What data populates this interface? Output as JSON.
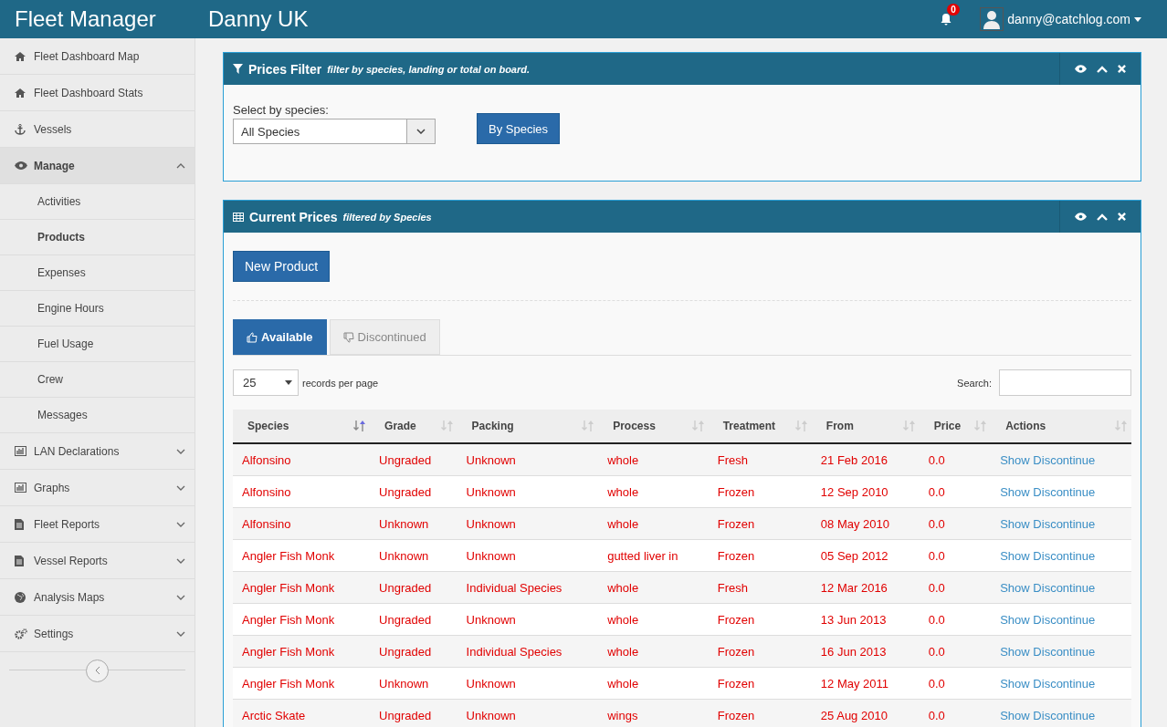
{
  "header": {
    "brand": "Fleet Manager",
    "account": "Danny UK",
    "notifications": "0",
    "user": "danny@catchlog.com"
  },
  "sidebar": {
    "items": [
      {
        "label": "Fleet Dashboard Map",
        "selected": false
      },
      {
        "label": "Fleet Dashboard Stats",
        "selected": false
      },
      {
        "label": "Vessels",
        "selected": false
      },
      {
        "label": "Manage",
        "expanded": true,
        "selected": true,
        "children": [
          {
            "label": "Activities",
            "selected": false
          },
          {
            "label": "Products",
            "selected": true
          },
          {
            "label": "Expenses",
            "selected": false
          },
          {
            "label": "Engine Hours",
            "selected": false
          },
          {
            "label": "Fuel Usage",
            "selected": false
          },
          {
            "label": "Crew",
            "selected": false
          },
          {
            "label": "Messages",
            "selected": false
          }
        ]
      },
      {
        "label": "LAN Declarations",
        "expanded": false,
        "selected": false
      },
      {
        "label": "Graphs",
        "expanded": false,
        "selected": false
      },
      {
        "label": "Fleet Reports",
        "expanded": false,
        "selected": false
      },
      {
        "label": "Vessel Reports",
        "expanded": false,
        "selected": false
      },
      {
        "label": "Analysis Maps",
        "expanded": false,
        "selected": false
      },
      {
        "label": "Settings",
        "expanded": false,
        "selected": false
      }
    ]
  },
  "filter_panel": {
    "title": "Prices Filter",
    "subtitle": "filter by species, landing or total on board.",
    "field_label": "Select by species:",
    "select_value": "All Species",
    "button": "By Species"
  },
  "prices_panel": {
    "title": "Current Prices",
    "subtitle": "filtered by Species",
    "new_button": "New Product",
    "tabs": [
      {
        "label": "Available",
        "selected": true
      },
      {
        "label": "Discontinued",
        "selected": false
      }
    ],
    "page_size": "25",
    "page_size_label": "records per page",
    "search_label": "Search:",
    "columns": [
      {
        "label": "Species",
        "sorted": true
      },
      {
        "label": "Grade",
        "sorted": false
      },
      {
        "label": "Packing",
        "sorted": false
      },
      {
        "label": "Process",
        "sorted": false
      },
      {
        "label": "Treatment",
        "sorted": false
      },
      {
        "label": "From",
        "sorted": false
      },
      {
        "label": "Price",
        "sorted": false
      },
      {
        "label": "Actions",
        "sorted": false
      }
    ],
    "rows": [
      {
        "cells": [
          "Alfonsino",
          "Ungraded",
          "Unknown",
          "whole",
          "Fresh",
          "21 Feb 2016",
          "0.0"
        ],
        "actions": [
          "Show",
          "Discontinue"
        ]
      },
      {
        "cells": [
          "Alfonsino",
          "Ungraded",
          "Unknown",
          "whole",
          "Frozen",
          "12 Sep 2010",
          "0.0"
        ],
        "actions": [
          "Show",
          "Discontinue"
        ]
      },
      {
        "cells": [
          "Alfonsino",
          "Unknown",
          "Unknown",
          "whole",
          "Frozen",
          "08 May 2010",
          "0.0"
        ],
        "actions": [
          "Show",
          "Discontinue"
        ]
      },
      {
        "cells": [
          "Angler Fish Monk",
          "Unknown",
          "Unknown",
          "gutted liver in",
          "Frozen",
          "05 Sep 2012",
          "0.0"
        ],
        "actions": [
          "Show",
          "Discontinue"
        ]
      },
      {
        "cells": [
          "Angler Fish Monk",
          "Ungraded",
          "Individual Species",
          "whole",
          "Fresh",
          "12 Mar 2016",
          "0.0"
        ],
        "actions": [
          "Show",
          "Discontinue"
        ]
      },
      {
        "cells": [
          "Angler Fish Monk",
          "Ungraded",
          "Unknown",
          "whole",
          "Frozen",
          "13 Jun 2013",
          "0.0"
        ],
        "actions": [
          "Show",
          "Discontinue"
        ]
      },
      {
        "cells": [
          "Angler Fish Monk",
          "Ungraded",
          "Individual Species",
          "whole",
          "Frozen",
          "16 Jun 2013",
          "0.0"
        ],
        "actions": [
          "Show",
          "Discontinue"
        ]
      },
      {
        "cells": [
          "Angler Fish Monk",
          "Unknown",
          "Unknown",
          "whole",
          "Frozen",
          "12 May 2011",
          "0.0"
        ],
        "actions": [
          "Show",
          "Discontinue"
        ]
      },
      {
        "cells": [
          "Arctic Skate",
          "Ungraded",
          "Unknown",
          "wings",
          "Frozen",
          "25 Aug 2010",
          "0.0"
        ],
        "actions": [
          "Show",
          "Discontinue"
        ]
      }
    ]
  }
}
